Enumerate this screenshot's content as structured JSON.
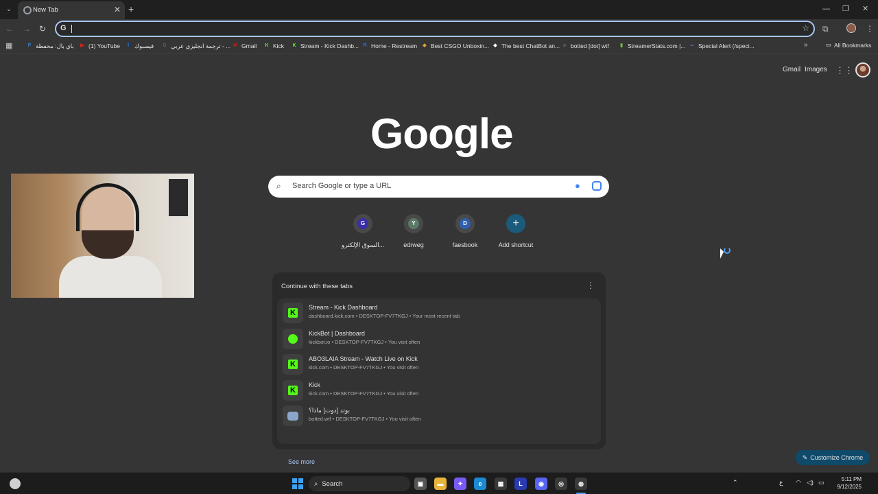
{
  "tab": {
    "title": "New Tab",
    "close": "✕"
  },
  "new_tab": "+",
  "window": {
    "minimize": "—",
    "restore": "❐",
    "close": "✕"
  },
  "nav": {
    "back": "←",
    "forward": "→",
    "reload": "↻"
  },
  "omnibox": {
    "icon": "G",
    "star": "☆"
  },
  "toolbar_icons": {
    "extensions": "⧉",
    "menu": "⋮"
  },
  "bookmarks": {
    "apps_icon": "▦",
    "items": [
      {
        "label": "باي بال: محفظة",
        "icon": "P",
        "color": "#3b7bbf"
      },
      {
        "label": "(1) YouTube",
        "icon": "▶",
        "color": "#e62117"
      },
      {
        "label": "فيسبوك",
        "icon": "f",
        "color": "#1877f2"
      },
      {
        "label": "ترجمة انجليزي عربي - ...",
        "icon": "G",
        "color": "#5f6368"
      },
      {
        "label": "Gmail",
        "icon": "M",
        "color": "#c5221f"
      },
      {
        "label": "Kick",
        "icon": "K",
        "color": "#53fc18"
      },
      {
        "label": "Stream - Kick Dashb...",
        "icon": "K",
        "color": "#53fc18"
      },
      {
        "label": "Home - Restream",
        "icon": "R",
        "color": "#2e6ff2"
      },
      {
        "label": "Best CSGO Unboxin...",
        "icon": "◆",
        "color": "#e8a33a"
      },
      {
        "label": "The best ChatBot an...",
        "icon": "◆",
        "color": "#ffffff"
      },
      {
        "label": "botted [dot] wtf",
        "icon": "☺",
        "color": "#8aa6c8"
      },
      {
        "label": "StreamerStats.com |...",
        "icon": "▮",
        "color": "#7cc142"
      },
      {
        "label": "Special Alert (/speci...",
        "icon": "∞",
        "color": "#5b6ee1"
      }
    ],
    "more": "»",
    "all": "All Bookmarks",
    "all_icon": "▭"
  },
  "top_links": {
    "gmail": "Gmail",
    "images": "Images",
    "apps_icon": "⋮⋮⋮"
  },
  "logo": "Google",
  "search": {
    "placeholder": "Search Google or type a URL",
    "icon": "⌕",
    "mic": "🎤"
  },
  "shortcuts": [
    {
      "label": "السوق الإلكترو...",
      "letter": "G",
      "color": "#3a2ea8"
    },
    {
      "label": "edrweg",
      "letter": "Y",
      "color": "#5a7a68"
    },
    {
      "label": "faesbook",
      "letter": "D",
      "color": "#2e5fb0"
    },
    {
      "label": "Add shortcut",
      "letter": "+",
      "color": ""
    }
  ],
  "continue": {
    "title": "Continue with these tabs",
    "menu": "⋮",
    "items": [
      {
        "title": "Stream - Kick Dashboard",
        "sub": "dashboard.kick.com • DESKTOP-FV7TKGJ • Your most recent tab",
        "icon": "kick"
      },
      {
        "title": "KickBot | Dashboard",
        "sub": "kickbot.io • DESKTOP-FV7TKGJ • You visit often",
        "icon": "kickbot"
      },
      {
        "title": "ABO3LAIA Stream - Watch Live on Kick",
        "sub": "kick.com • DESKTOP-FV7TKGJ • You visit often",
        "icon": "kick"
      },
      {
        "title": "Kick",
        "sub": "kick.com • DESKTOP-FV7TKGJ • You visit often",
        "icon": "kick"
      },
      {
        "title": "بوتد [دوت] ماذا؟",
        "sub": "botted.wtf • DESKTOP-FV7TKGJ • You visit often",
        "icon": "bot"
      }
    ],
    "see_more": "See more"
  },
  "customize": {
    "label": "Customize Chrome",
    "icon": "✎"
  },
  "taskbar": {
    "search_label": "Search",
    "search_icon": "⌕",
    "apps": [
      {
        "name": "task-view",
        "glyph": "▣",
        "color": "#555"
      },
      {
        "name": "file-explorer",
        "glyph": "▬",
        "color": "#e8b43a"
      },
      {
        "name": "copilot",
        "glyph": "✦",
        "color": "#7a5af5"
      },
      {
        "name": "edge",
        "glyph": "e",
        "color": "#1a8ad4"
      },
      {
        "name": "store",
        "glyph": "▦",
        "color": "#3a3a3a"
      },
      {
        "name": "app-l",
        "glyph": "L",
        "color": "#2a3ab0"
      },
      {
        "name": "discord",
        "glyph": "◉",
        "color": "#5865f2"
      },
      {
        "name": "app-circle",
        "glyph": "◎",
        "color": "#3a3a3a"
      },
      {
        "name": "chrome",
        "glyph": "◍",
        "color": "#3a3a3a"
      }
    ],
    "tray": {
      "chevron": "⌃",
      "lang": "ع",
      "wifi": "◠",
      "volume": "◁)",
      "battery": "▭"
    },
    "time": "5:11 PM",
    "date": "9/12/2025"
  }
}
